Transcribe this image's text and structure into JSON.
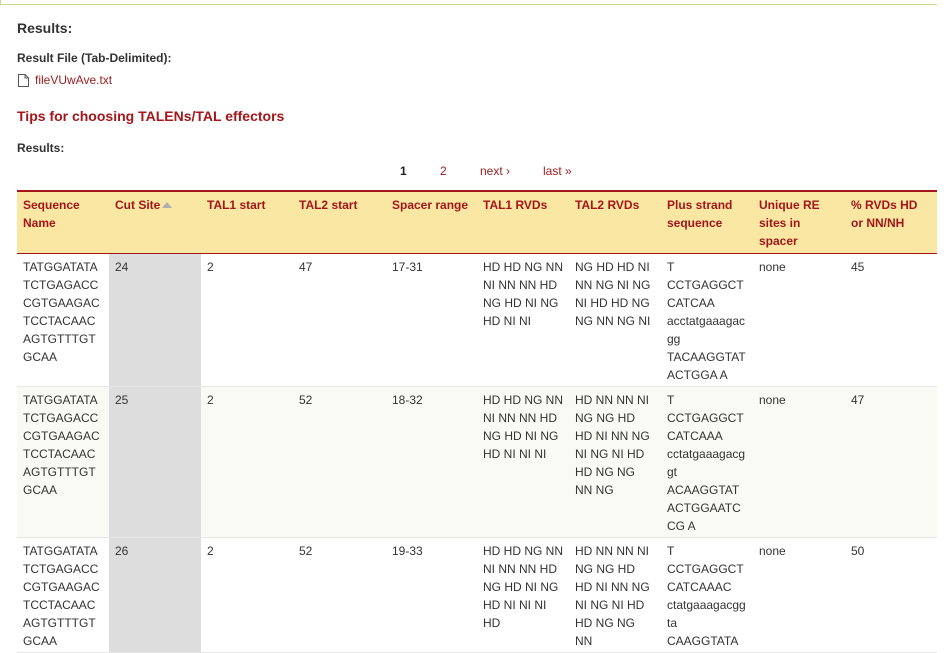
{
  "page": {
    "results_heading": "Results:",
    "result_file_label": "Result File (Tab-Delimited):",
    "file_name": "fileVUwAve.txt",
    "file_icon": "document-icon",
    "tips_link": "Tips for choosing TALENs/TAL effectors",
    "results_label": "Results:"
  },
  "pagination": {
    "current": "1",
    "page2": "2",
    "next": "next ›",
    "last": "last »"
  },
  "colors": {
    "accent": "#a4161a",
    "header_bg": "#f9e7a3",
    "sorted_column_bg": "#dddddd"
  },
  "table": {
    "headers": [
      "Sequence Name",
      "Cut Site",
      "TAL1 start",
      "TAL2 start",
      "Spacer range",
      "TAL1 RVDs",
      "TAL2 RVDs",
      "Plus strand sequence",
      "Unique RE sites in spacer",
      "% RVDs HD or NN/NH"
    ],
    "sorted_column": "Cut Site",
    "rows": [
      [
        "TATGGATATATCTGAGACCCGTGAAGACTCCTACAACAGTGTTTGTGCAA",
        "24",
        "2",
        "47",
        "17-31",
        "HD HD NG NN NI NN NN HD NG HD NI NG HD NI NI",
        "NG HD HD NI NN NG NI NG NI HD HD NG NG NN NG NI",
        "T CCTGAGGCT CATCAA acctatgaaagacgg TACAAGGTAT ACTGGA A",
        "none",
        "45"
      ],
      [
        "TATGGATATATCTGAGACCCGTGAAGACTCCTACAACAGTGTTTGTGCAA",
        "25",
        "2",
        "52",
        "18-32",
        "HD HD NG NN NI NN NN HD NG HD NI NG HD NI NI NI",
        "HD NN NN NI NG NG HD HD NI NN NG NI NG NI HD HD NG NG NN NG",
        "T CCTGAGGCT CATCAAA cctatgaaagacggt ACAAGGTAT ACTGGAATC CG A",
        "none",
        "47"
      ],
      [
        "TATGGATATATCTGAGACCCGTGAAGACTCCTACAACAGTGTTTGTGCAA",
        "26",
        "2",
        "52",
        "19-33",
        "HD HD NG NN NI NN NN HD NG HD NI NG HD NI NI NI HD",
        "HD NN NN NI NG NG HD HD NI NN NG NI NG NI HD HD NG NG NN",
        "T CCTGAGGCT CATCAAAC ctatgaaagacggta CAAGGTATA",
        "none",
        "50"
      ]
    ]
  }
}
